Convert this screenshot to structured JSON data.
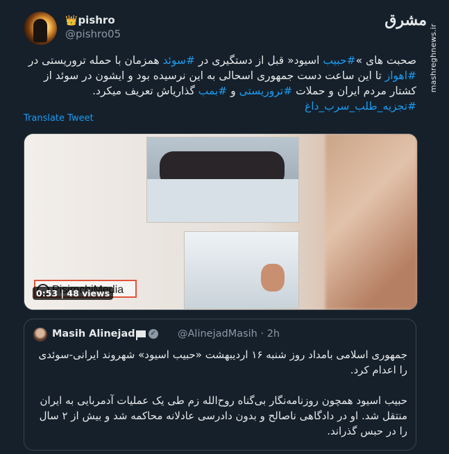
{
  "author": {
    "display_name": "pishro",
    "badge": "👑",
    "handle": "@pishro05"
  },
  "site_logo": {
    "mark": "مشرق",
    "vertical_text": "mashreghnews.ir"
  },
  "tweet": {
    "segments": [
      {
        "text": "صحبت های »",
        "tag": false
      },
      {
        "text": "#حبیب",
        "tag": true
      },
      {
        "text": " اسیود« قبل از دستگیری در ",
        "tag": false
      },
      {
        "text": "#سوئد",
        "tag": true
      },
      {
        "text": " همزمان با حمله تروریستی در ",
        "tag": false
      },
      {
        "text": "#اهواز",
        "tag": true
      },
      {
        "text": " تا این ساعت دست جمهوری اسحالی به این نرسیده بود و ایشون در سوئد از کشتار مردم ایران و حملات ",
        "tag": false
      },
      {
        "text": "#تروریستی",
        "tag": true
      },
      {
        "text": " و ",
        "tag": false
      },
      {
        "text": "#بمب",
        "tag": true
      },
      {
        "text": " گذاریاش تعریف میکرد. ",
        "tag": false
      },
      {
        "text": "#تجزیه_طلب_سرب_داغ",
        "tag": true
      }
    ],
    "translate_label": "Translate Tweet"
  },
  "media": {
    "watermark": "PisimchiMedia",
    "duration": "0:53",
    "views": "48 views"
  },
  "quoted_tweet": {
    "name": "Masih Alinejad",
    "handle": "@AlinejadMasih",
    "time": "2h",
    "paragraphs": [
      "جمهوری اسلامی بامداد روز شنبه ۱۶ اردیبهشت «حبیب اسیود» شهروند ایرانی-سوئدی را اعدام کرد.",
      "حبیب اسیود همچون روزنامه‌نگار بی‌گناه روح‌الله زم طی یک عملیات آدمربایی به ایران منتقل شد. او در دادگاهی ناصالح و بدون دادرسی عادلانه محاکمه شد و بیش از ۲ سال را در حبس گذراند."
    ]
  },
  "colors": {
    "background": "#15202b",
    "link": "#1d9bf0",
    "secondary_text": "#8b98a5",
    "border": "#38444d",
    "watermark_border": "#e0533a"
  }
}
